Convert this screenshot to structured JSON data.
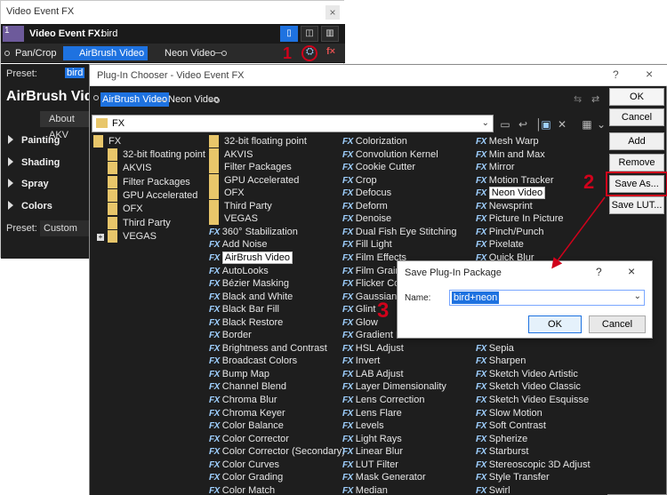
{
  "background_window": {
    "title": "Video Event FX",
    "close_glyph": "×",
    "header_label": "Video Event FX:",
    "event_name": "bird",
    "thumb_label": "1",
    "chain": [
      "Pan/Crop",
      "AirBrush Video",
      "Neon Video"
    ],
    "preset_label": "Preset:",
    "preset_value": "bird",
    "plugin_title": "AirBrush Vide",
    "about_label": "About AKV",
    "sections": [
      "Painting",
      "Shading",
      "Spray",
      "Colors"
    ],
    "preset2_label": "Preset:",
    "preset2_value": "Custom"
  },
  "annotations": {
    "one": "1",
    "two": "2",
    "three": "3",
    "color": "#d0021b"
  },
  "chooser": {
    "title": "Plug-In Chooser - Video Event FX",
    "help": "?",
    "close": "×",
    "chain": [
      "AirBrush Video",
      "Neon Video"
    ],
    "path": "FX",
    "tree": {
      "root": "FX",
      "children": [
        "32-bit floating point",
        "AKVIS",
        "Filter Packages",
        "GPU Accelerated",
        "OFX",
        "Third Party"
      ],
      "vegas": "VEGAS"
    },
    "col1_folders": [
      "32-bit floating point",
      "AKVIS",
      "Filter Packages",
      "GPU Accelerated",
      "OFX",
      "Third Party",
      "VEGAS"
    ],
    "col1_fx": [
      "360° Stabilization",
      "Add Noise",
      "AirBrush Video",
      "AutoLooks",
      "Bézier Masking",
      "Black and White",
      "Black Bar Fill",
      "Black Restore",
      "Border",
      "Brightness and Contrast",
      "Broadcast Colors",
      "Bump Map",
      "Channel Blend",
      "Chroma Blur",
      "Chroma Keyer",
      "Color Balance",
      "Color Corrector",
      "Color Corrector (Secondary)",
      "Color Curves",
      "Color Grading",
      "Color Match"
    ],
    "col2_fx": [
      "Colorization",
      "Convolution Kernel",
      "Cookie Cutter",
      "Crop",
      "Defocus",
      "Deform",
      "Denoise",
      "Dual Fish Eye Stitching",
      "Fill Light",
      "Film Effects",
      "Film Grain",
      "Flicker Cor",
      "Gaussian B",
      "Glint",
      "Glow",
      "Gradient M",
      "HSL Adjust",
      "Invert",
      "LAB Adjust",
      "Layer Dimensionality",
      "Lens Correction",
      "Lens Flare",
      "Levels",
      "Light Rays",
      "Linear Blur",
      "LUT Filter",
      "Mask Generator",
      "Median"
    ],
    "col3_fx": [
      "Mesh Warp",
      "Min and Max",
      "Mirror",
      "Motion Tracker",
      "Neon Video",
      "Newsprint",
      "Picture In Picture",
      "Pinch/Punch",
      "Pixelate",
      "Quick Blur",
      "",
      "",
      "",
      "",
      "",
      "",
      "Sepia",
      "Sharpen",
      "Sketch Video Artistic",
      "Sketch Video Classic",
      "Sketch Video Esquisse",
      "Slow Motion",
      "Soft Contrast",
      "Spherize",
      "Starburst",
      "Stereoscopic 3D Adjust",
      "Style Transfer",
      "Swirl"
    ],
    "fx_glyph": "FX",
    "buttons": {
      "ok": "OK",
      "cancel": "Cancel",
      "add": "Add",
      "remove": "Remove",
      "save_as": "Save As...",
      "save_lut": "Save LUT..."
    }
  },
  "save_dialog": {
    "title": "Save Plug-In Package",
    "help": "?",
    "close": "×",
    "name_label": "Name:",
    "name_value": "bird+neon",
    "ok": "OK",
    "cancel": "Cancel"
  }
}
